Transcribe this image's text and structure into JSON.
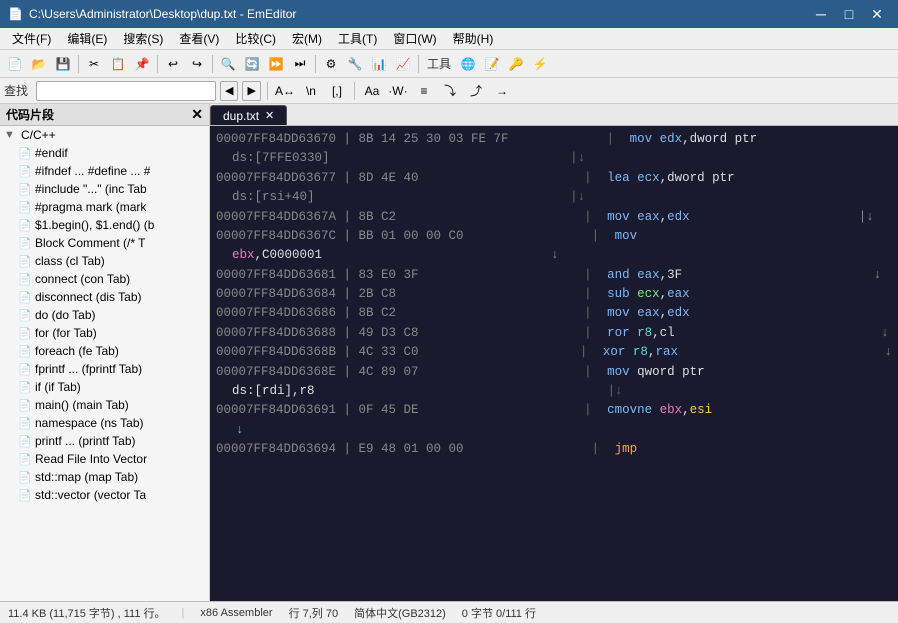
{
  "titlebar": {
    "title": "C:\\Users\\Administrator\\Desktop\\dup.txt - EmEditor",
    "icon": "📄",
    "controls": [
      "─",
      "□",
      "✕"
    ]
  },
  "menubar": {
    "items": [
      "文件(F)",
      "编辑(E)",
      "搜索(S)",
      "查看(V)",
      "比较(C)",
      "宏(M)",
      "工具(T)",
      "窗口(W)",
      "帮助(H)"
    ]
  },
  "search": {
    "label": "查找",
    "placeholder": "",
    "value": ""
  },
  "sidebar": {
    "title": "代码片段",
    "root": {
      "label": "C/C++",
      "items": [
        {
          "label": "#endif"
        },
        {
          "label": "#ifndef ... #define ... #"
        },
        {
          "label": "#include \"...\" (inc Tab"
        },
        {
          "label": "#pragma mark (mark"
        },
        {
          "label": "$1.begin(), $1.end() (b"
        },
        {
          "label": "Block Comment (/* T"
        },
        {
          "label": "class (cl Tab)"
        },
        {
          "label": "connect (con Tab)"
        },
        {
          "label": "disconnect (dis Tab)"
        },
        {
          "label": "do (do Tab)"
        },
        {
          "label": "for (for Tab)"
        },
        {
          "label": "foreach (fe Tab)"
        },
        {
          "label": "fprintf ... (fprintf Tab)"
        },
        {
          "label": "if (if Tab)"
        },
        {
          "label": "main() (main Tab)"
        },
        {
          "label": "namespace (ns Tab)"
        },
        {
          "label": "printf ... (printf Tab)"
        },
        {
          "label": "Read File Into Vector"
        },
        {
          "label": "std::map (map Tab)"
        },
        {
          "label": "std::vector (vector Ta"
        }
      ]
    }
  },
  "tabs": [
    {
      "label": "dup.txt",
      "active": true
    }
  ],
  "code": {
    "lines": [
      {
        "addr": "00007FF84DD63670",
        "sep": "|",
        "hex": "8B 14 25 30 03 FE 7F",
        "pipe": "|",
        "asm": "mov edx,dword ptr",
        "arrow": ""
      },
      {
        "addr": "ds:[7FFE0330]",
        "sep": "",
        "hex": "",
        "pipe": "|↓",
        "asm": "",
        "arrow": ""
      },
      {
        "addr": "00007FF84DD63677",
        "sep": "|",
        "hex": "8D 4E 40",
        "pipe": "|",
        "asm": "lea ecx,dword ptr",
        "arrow": ""
      },
      {
        "addr": "ds:[rsi+40]",
        "sep": "",
        "hex": "",
        "pipe": "|↓",
        "asm": "",
        "arrow": ""
      },
      {
        "addr": "00007FF84DD6367A",
        "sep": "|",
        "hex": "8B C2",
        "pipe": "|",
        "asm": "mov eax,edx",
        "arrow": "↓"
      },
      {
        "addr": "00007FF84DD6367C",
        "sep": "|",
        "hex": "BB 01 00 00 C0",
        "pipe": "|",
        "asm": "mov",
        "arrow": ""
      },
      {
        "addr": "ebx,C0000001",
        "sep": "",
        "hex": "",
        "pipe": "",
        "asm": "",
        "arrow": "↓"
      },
      {
        "addr": "00007FF84DD63681",
        "sep": "|",
        "hex": "83 E0 3F",
        "pipe": "|",
        "asm": "and eax,3F",
        "arrow": "↓"
      },
      {
        "addr": "00007FF84DD63684",
        "sep": "|",
        "hex": "2B C8",
        "pipe": "|",
        "asm": "sub ecx,eax",
        "arrow": ""
      },
      {
        "addr": "00007FF84DD63686",
        "sep": "|",
        "hex": "8B C2",
        "pipe": "|",
        "asm": "mov eax,edx",
        "arrow": ""
      },
      {
        "addr": "00007FF84DD63688",
        "sep": "|",
        "hex": "49 D3 C8",
        "pipe": "|",
        "asm": "ror r8,cl",
        "arrow": "↓"
      },
      {
        "addr": "00007FF84DD6368B",
        "sep": "|",
        "hex": "4C 33 C0",
        "pipe": "|",
        "asm": "xor r8,rax",
        "arrow": "↓"
      },
      {
        "addr": "00007FF84DD6368E",
        "sep": "|",
        "hex": "4C 89 07",
        "pipe": "|",
        "asm": "mov qword ptr",
        "arrow": ""
      },
      {
        "addr": "ds:[rdi],r8",
        "sep": "",
        "hex": "",
        "pipe": "|↓",
        "asm": "",
        "arrow": ""
      },
      {
        "addr": "00007FF84DD63691",
        "sep": "|",
        "hex": "0F 45 DE",
        "pipe": "|",
        "asm": "cmovne ebx,esi",
        "arrow": ""
      },
      {
        "addr": "↓",
        "sep": "",
        "hex": "",
        "pipe": "",
        "asm": "",
        "arrow": ""
      },
      {
        "addr": "00007FF84DD63694",
        "sep": "|",
        "hex": "E9 48 01 00 00",
        "pipe": "|",
        "asm": "jmp",
        "arrow": ""
      }
    ]
  },
  "statusbar": {
    "filesize": "11.4 KB (11,715 字节) , 111 行。",
    "encoding": "x86 Assembler",
    "position": "行 7,列 70",
    "charset": "简体中文(GB2312)",
    "selection": "0 字节 0/111 行"
  }
}
